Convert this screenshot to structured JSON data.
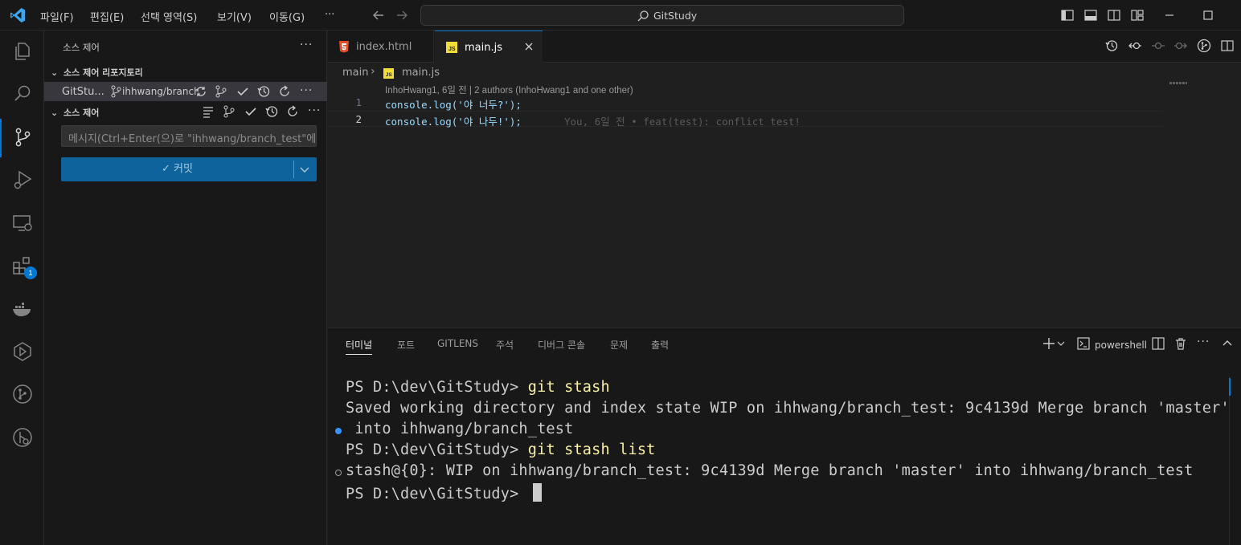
{
  "menu": [
    "파일(F)",
    "편집(E)",
    "선택 영역(S)",
    "보기(V)",
    "이동(G)"
  ],
  "menu_more": "···",
  "search": {
    "text": "GitStudy"
  },
  "activity": {
    "extensions_badge": "1"
  },
  "sidebar": {
    "title": "소스 제어",
    "more": "···",
    "repos_section": "소스 제어 리포지토리",
    "repo_name": "GitStu...",
    "repo_branch": "ihhwang/branch_test",
    "changes_section": "소스 제어",
    "commit_placeholder": "메시지(Ctrl+Enter(으)로 \"ihhwang/branch_test\"에 커밋)",
    "commit_label": "✓ 커밋"
  },
  "tabs": [
    {
      "label": "index.html"
    },
    {
      "label": "main.js"
    }
  ],
  "breadcrumb": {
    "folder": "main",
    "file": "main.js"
  },
  "blame": "InhoHwang1, 6일 전 | 2 authors (InhoHwang1 and one other)",
  "code": [
    {
      "line": "1",
      "text": "console.log('야 너두?');",
      "annotation": ""
    },
    {
      "line": "2",
      "text": "console.log('야 나두!');",
      "annotation": "You, 6일 전 • feat(test): conflict test!"
    }
  ],
  "panel": {
    "tabs": [
      "터미널",
      "포트",
      "GITLENS",
      "주석",
      "디버그 콘솔",
      "문제",
      "출력"
    ],
    "shell": "powershell",
    "more": "···"
  },
  "terminal": {
    "prompt": "PS D:\\dev\\GitStudy> ",
    "cmd1": "git stash",
    "out1a": "Saved working directory and index state WIP on ihhwang/branch_test: 9c4139d Merge branch 'master'",
    "out1b": " into ihhwang/branch_test",
    "cmd2": "git stash list",
    "out2": "stash@{0}: WIP on ihhwang/branch_test: 9c4139d Merge branch 'master' into ihhwang/branch_test"
  },
  "colors": {
    "accent": "#0078d4",
    "command": "#f9f1a5",
    "commit_button": "#0e639c"
  }
}
